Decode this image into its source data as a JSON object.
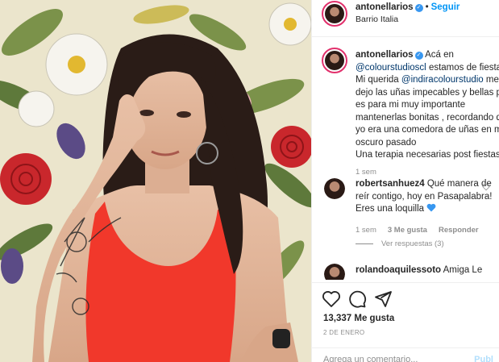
{
  "post_header": {
    "username": "antonellarios",
    "follow_label": "Seguir",
    "location": "Barrio Italia"
  },
  "caption": {
    "username": "antonellarios",
    "lines": [
      "Acá en",
      "@colourstudioscl",
      " estamos de fiesta",
      "Mi querida ",
      "@indiracolourstudio",
      " me",
      "dejo las uñas impecables y bellas pu",
      "es para mi muy importante",
      "mantenerlas bonitas , recordando q",
      "yo era una comedora de uñas en m",
      "oscuro pasado",
      "Una terapia necesarias post fiestas"
    ],
    "time": "1 sem"
  },
  "comments": [
    {
      "username": "robertsanhuez4",
      "text_line1": "Qué manera de",
      "text_line2": "reír contigo, hoy en Pasapalabra!",
      "text_line3": "Eres una loquilla",
      "emoji": "blue-heart",
      "time": "1 sem",
      "likes": "3 Me gusta",
      "reply_label": "Responder",
      "view_replies": "Ver respuestas (3)"
    },
    {
      "username": "rolandoaquilessoto",
      "text_line1": "Amiga Le"
    }
  ],
  "actions": {
    "like_icon": "heart-icon",
    "comment_icon": "comment-icon",
    "share_icon": "share-icon",
    "likes_count": "13,337 Me gusta",
    "date": "2 DE ENERO"
  },
  "add_comment": {
    "placeholder": "Agrega un comentario...",
    "post_label": "Publ"
  },
  "colors": {
    "accent_blue": "#0095f6",
    "mention": "#00376b",
    "verified": "#3897f0",
    "heart_emoji": "#3897f0",
    "top_red": "#ff3b2f"
  }
}
